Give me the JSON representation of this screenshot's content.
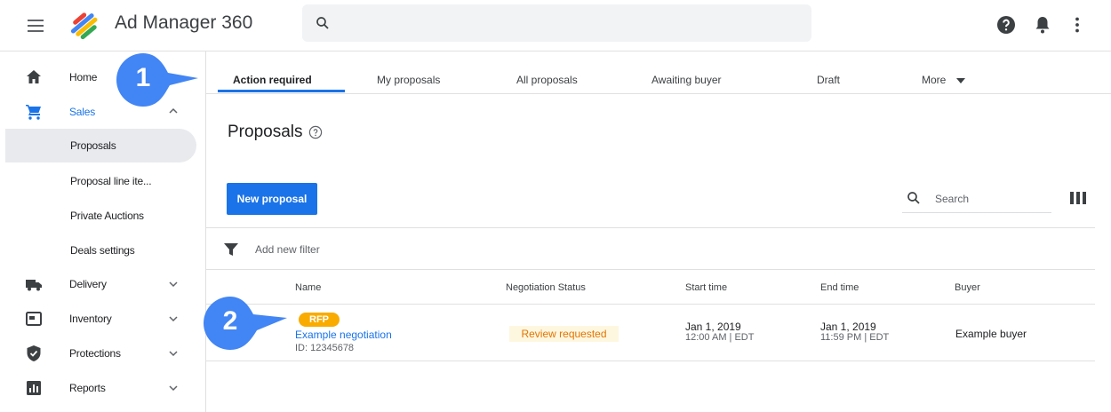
{
  "header": {
    "app_title": "Ad Manager 360",
    "icons": [
      "menu-icon",
      "ad-manager-logo",
      "search-icon",
      "help-icon",
      "notifications-icon",
      "more-vert-icon"
    ]
  },
  "sidebar": {
    "items": [
      {
        "label": "Home",
        "icon": "home-icon"
      },
      {
        "label": "Sales",
        "icon": "cart-icon",
        "expanded": true
      },
      {
        "label": "Proposals",
        "selected": true
      },
      {
        "label": "Proposal line ite..."
      },
      {
        "label": "Private Auctions"
      },
      {
        "label": "Deals settings"
      },
      {
        "label": "Delivery",
        "icon": "truck-icon"
      },
      {
        "label": "Inventory",
        "icon": "inventory-icon"
      },
      {
        "label": "Protections",
        "icon": "shield-icon"
      },
      {
        "label": "Reports",
        "icon": "reports-icon"
      }
    ]
  },
  "tabs": [
    "Action required",
    "My proposals",
    "All proposals",
    "Awaiting buyer",
    "Draft",
    "More"
  ],
  "active_tab": "Action required",
  "main": {
    "title": "Proposals",
    "new_button": "New proposal",
    "search_placeholder": "Search",
    "filter_label": "Add new filter"
  },
  "table": {
    "columns": [
      "Name",
      "Negotiation Status",
      "Start time",
      "End time",
      "Buyer"
    ],
    "rows": [
      {
        "badge": "RFP",
        "name": "Example negotiation",
        "id": "ID: 12345678",
        "status": "Review requested",
        "start_date": "Jan 1, 2019",
        "start_time": "12:00 AM | EDT",
        "end_date": "Jan 1, 2019",
        "end_time": "11:59 PM | EDT",
        "buyer": "Example buyer"
      }
    ]
  },
  "callouts": [
    "1",
    "2"
  ],
  "colors": {
    "accent": "#1a73e8",
    "callout": "#4285f4",
    "badge": "#f9ab00",
    "status_text": "#e37400",
    "status_bg": "#fef7e0"
  }
}
